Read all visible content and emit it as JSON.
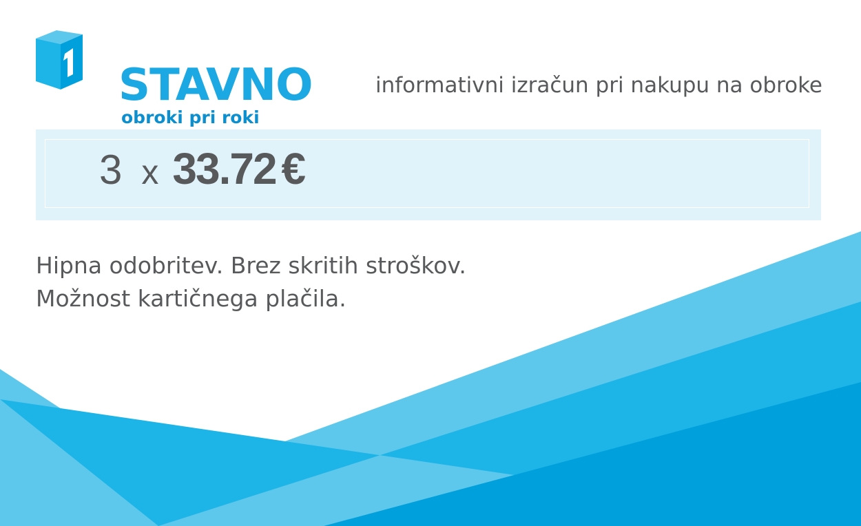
{
  "colors": {
    "brand_blue": "#1ba8e3",
    "dark_blue": "#0b8fcf",
    "light_blue": "#5ec8ec",
    "mid_blue": "#1db5e7",
    "deep_blue": "#00a0dc",
    "panel_bg": "#e0f3fb",
    "text_gray": "#58595b"
  },
  "logo": {
    "numeral": "1",
    "word": "STAVNO",
    "tagline": "obroki pri roki",
    "icon": "cube-logo-icon"
  },
  "header": {
    "subtitle": "informativni izračun pri nakupu na obroke"
  },
  "price": {
    "installments": "3",
    "times": "x",
    "amount": "33.72",
    "currency": "€"
  },
  "benefits": [
    "Hipna odobritev. Brez skritih stroškov.",
    "Možnost kartičnega plačila."
  ]
}
